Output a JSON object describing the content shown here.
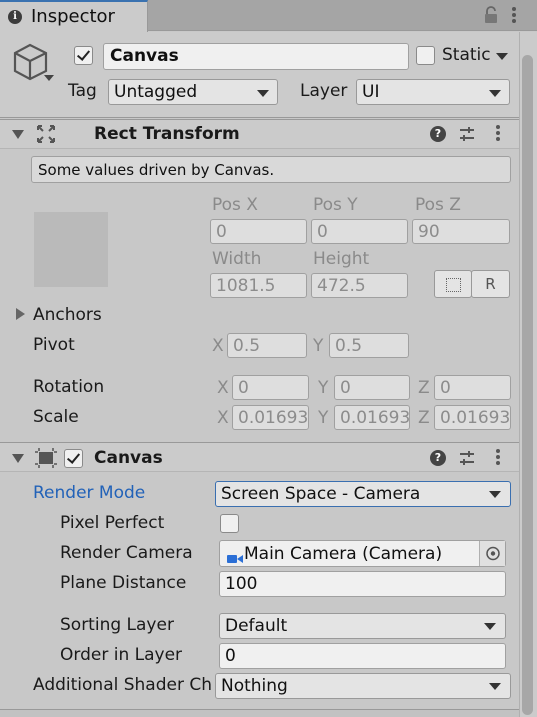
{
  "tab": {
    "title": "Inspector"
  },
  "gameobject": {
    "active": true,
    "name": "Canvas",
    "static_label": "Static",
    "tag_label": "Tag",
    "tag_value": "Untagged",
    "layer_label": "Layer",
    "layer_value": "UI"
  },
  "rect_transform": {
    "title": "Rect Transform",
    "note": "Some values driven by Canvas.",
    "pos_x_label": "Pos X",
    "pos_y_label": "Pos Y",
    "pos_z_label": "Pos Z",
    "pos_x": "0",
    "pos_y": "0",
    "pos_z": "90",
    "width_label": "Width",
    "height_label": "Height",
    "width": "1081.5",
    "height": "472.5",
    "r_button": "R",
    "anchors_label": "Anchors",
    "pivot_label": "Pivot",
    "pivot_x": "0.5",
    "pivot_y": "0.5",
    "rotation_label": "Rotation",
    "rot_x": "0",
    "rot_y": "0",
    "rot_z": "0",
    "scale_label": "Scale",
    "scale_x": "0.01693",
    "scale_y": "0.01693",
    "scale_z": "0.01693",
    "x": "X",
    "y": "Y",
    "z": "Z"
  },
  "canvas": {
    "title": "Canvas",
    "enabled": true,
    "render_mode_label": "Render Mode",
    "render_mode_value": "Screen Space - Camera",
    "pixel_perfect_label": "Pixel Perfect",
    "render_camera_label": "Render Camera",
    "render_camera_value": "Main Camera (Camera)",
    "plane_distance_label": "Plane Distance",
    "plane_distance_value": "100",
    "sorting_layer_label": "Sorting Layer",
    "sorting_layer_value": "Default",
    "order_label": "Order in Layer",
    "order_value": "0",
    "shader_label": "Additional Shader Ch",
    "shader_value": "Nothing"
  },
  "colors": {
    "accent_blue": "#2262b8",
    "tab_highlight": "#3a72b0"
  }
}
